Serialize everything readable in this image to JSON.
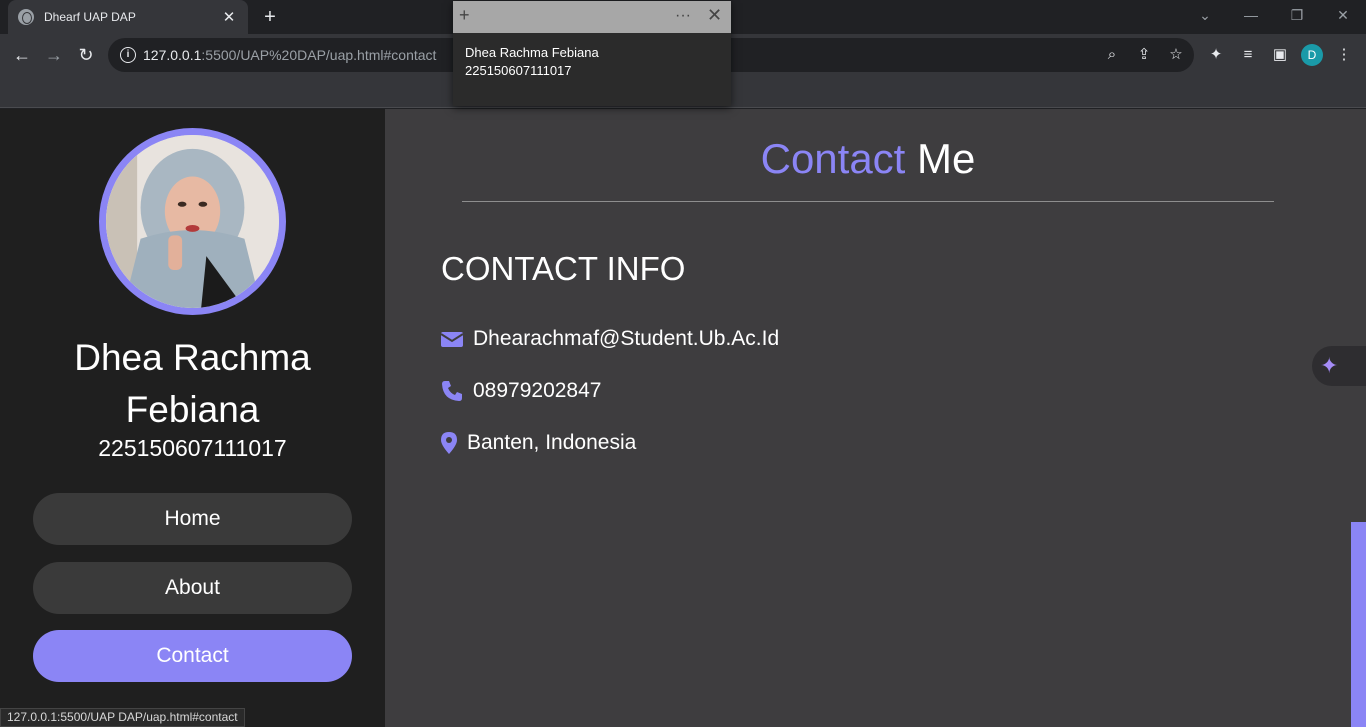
{
  "browser": {
    "tab_title": "Dhearf UAP DAP",
    "tab_close": "✕",
    "new_tab": "+",
    "window_controls": {
      "minimize": "—",
      "restore": "❐",
      "close": "✕",
      "tab_search": "⌄"
    },
    "url_host": "127.0.0.1",
    "url_rest": ":5500/UAP%20DAP/uap.html#contact",
    "profile_initial": "D",
    "status_url": "127.0.0.1:5500/UAP DAP/uap.html#contact"
  },
  "popup": {
    "line1": "Dhea Rachma Febiana",
    "line2": "225150607111017"
  },
  "sidebar": {
    "name_line1": "Dhea Rachma",
    "name_line2": "Febiana",
    "nim": "225150607111017",
    "nav": [
      {
        "label": "Home",
        "active": false
      },
      {
        "label": "About",
        "active": false
      },
      {
        "label": "Contact",
        "active": true
      }
    ]
  },
  "main": {
    "heading_accent": "Contact",
    "heading_rest": "Me",
    "contact_info_title": "CONTACT INFO",
    "email": "Dhearachmaf@Student.Ub.Ac.Id",
    "phone": "08979202847",
    "location": "Banten, Indonesia"
  },
  "colors": {
    "accent": "#8b85f5",
    "sidebar_bg": "#1f1f1f",
    "main_bg": "#3e3d3f"
  }
}
